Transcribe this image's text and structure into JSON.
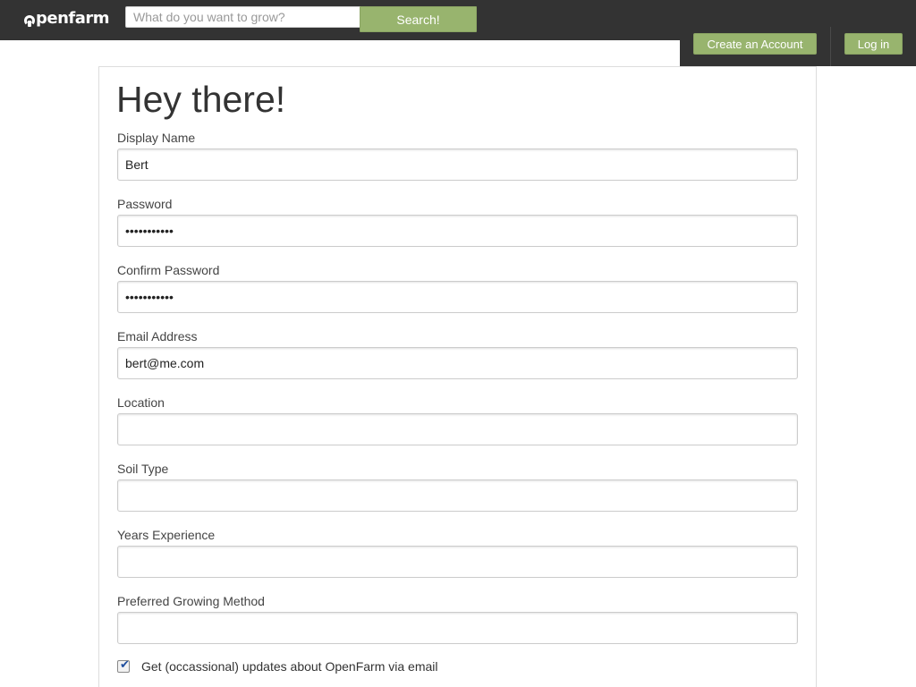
{
  "header": {
    "logo_text": "penfarm",
    "search": {
      "placeholder": "What do you want to grow?",
      "value": ""
    },
    "search_button": "Search!",
    "create_account_button": "Create an Account",
    "login_button": "Log in"
  },
  "form": {
    "title": "Hey there!",
    "fields": [
      {
        "label": "Display Name",
        "value": "Bert",
        "type": "text"
      },
      {
        "label": "Password",
        "value": "•••••••••••",
        "type": "password"
      },
      {
        "label": "Confirm Password",
        "value": "•••••••••••",
        "type": "password"
      },
      {
        "label": "Email Address",
        "value": "bert@me.com",
        "type": "text"
      },
      {
        "label": "Location",
        "value": "",
        "type": "text"
      },
      {
        "label": "Soil Type",
        "value": "",
        "type": "text"
      },
      {
        "label": "Years Experience",
        "value": "",
        "type": "text"
      },
      {
        "label": "Preferred Growing Method",
        "value": "",
        "type": "text"
      }
    ],
    "updates_checkbox": {
      "label": "Get (occassional) updates about OpenFarm via email",
      "checked": true,
      "check_glyph": "✔"
    }
  },
  "colors": {
    "topbar": "#333333",
    "accent_green": "#98b46e"
  },
  "icons": {
    "logo": "openfarm-logo-icon",
    "checkbox": "checkmark-icon"
  }
}
